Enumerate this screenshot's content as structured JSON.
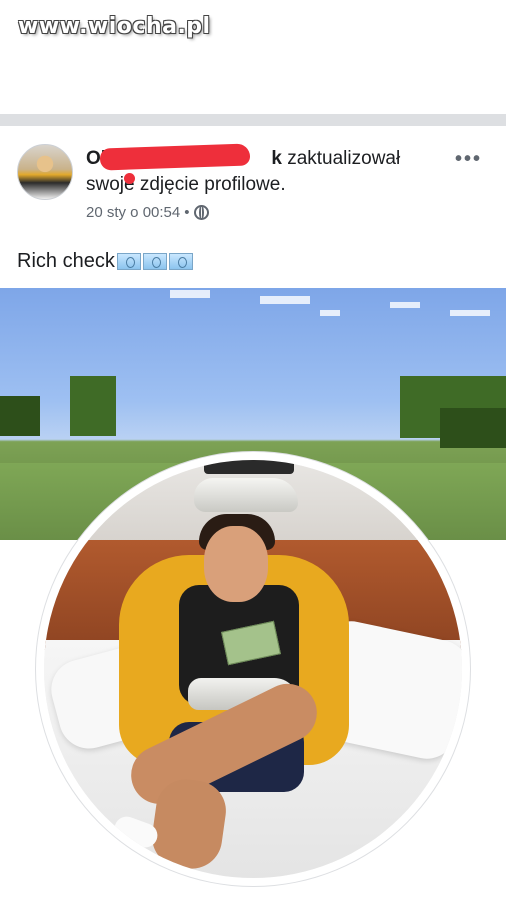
{
  "watermark": "www.wiocha.pl",
  "post": {
    "author_visible": "Oli",
    "author_suffix": "k",
    "action_text": " zaktualizował swoje zdjęcie profilowe.",
    "timestamp": "20 sty o 00:54",
    "separator": "•",
    "more_label": "•••",
    "caption": "Rich check",
    "caption_emoji_count": 3,
    "icons": {
      "privacy": "globe-icon",
      "more": "more-options-icon",
      "emoji": "dollar-banknote-icon"
    }
  },
  "colors": {
    "separator": "#dddfe2",
    "redaction": "#ee2f3b",
    "meta_text": "#606770",
    "jacket": "#e8a91f"
  }
}
